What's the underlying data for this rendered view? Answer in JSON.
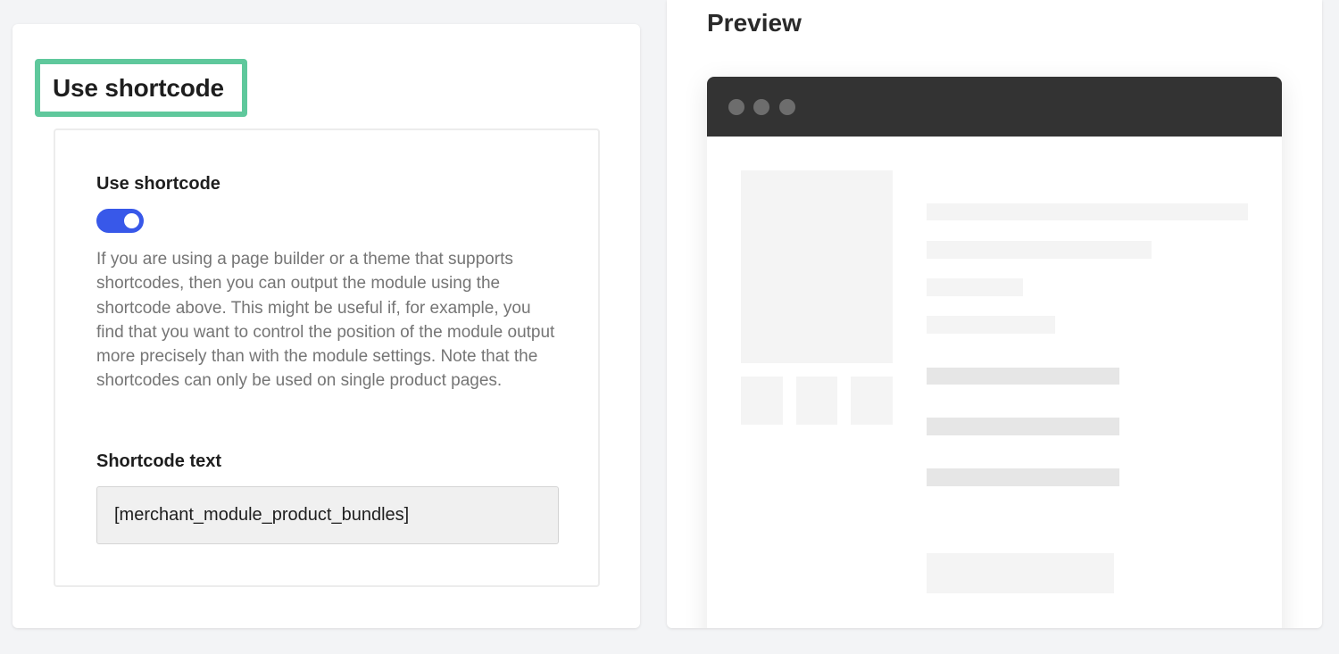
{
  "settings": {
    "section_title": "Use shortcode",
    "toggle_label": "Use shortcode",
    "toggle_on": true,
    "description": "If you are using a page builder or a theme that supports shortcodes, then you can output the module using the shortcode above. This might be useful if, for example, you find that you want to control the position of the module output more precisely than with the module settings. Note that the shortcodes can only be used on single product pages.",
    "shortcode_label": "Shortcode text",
    "shortcode_value": "[merchant_module_product_bundles]"
  },
  "preview": {
    "title": "Preview"
  },
  "colors": {
    "highlight_border": "#5fc89c",
    "toggle_active": "#3858e9",
    "browser_bar": "#333333"
  }
}
